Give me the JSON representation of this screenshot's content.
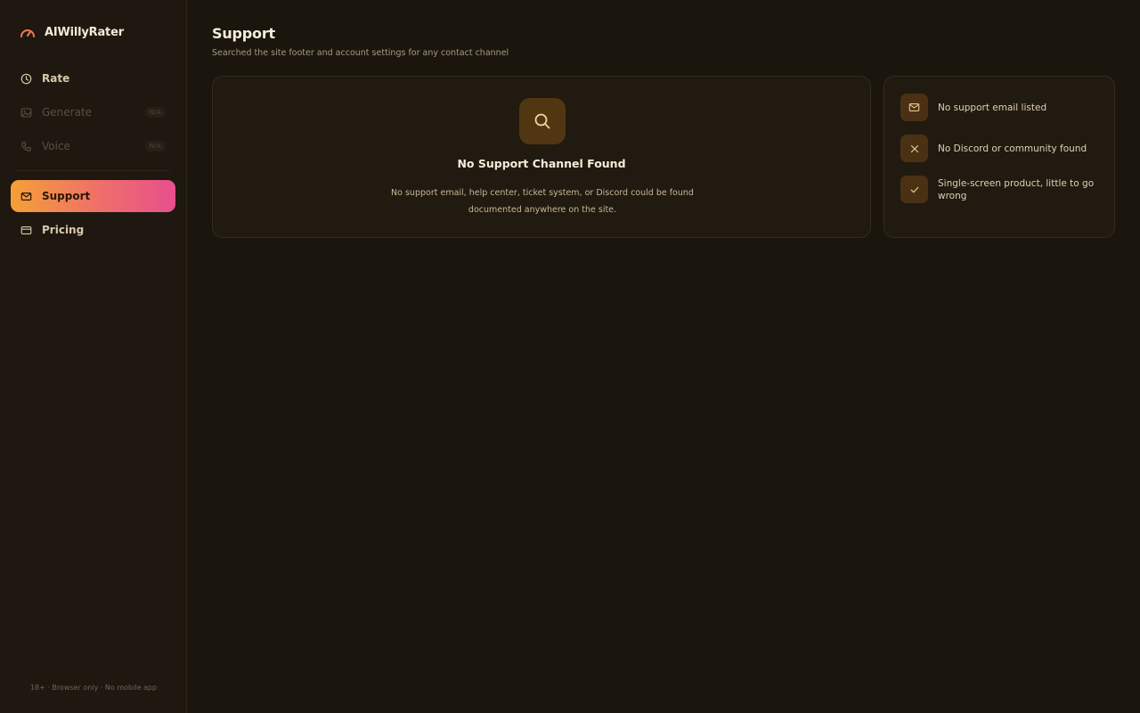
{
  "brand": {
    "name": "AIWillyRater",
    "logo_icon": "gauge-icon",
    "accent": "#f07a52"
  },
  "nav": {
    "items": [
      {
        "label": "Rate",
        "icon": "clock-icon",
        "badge": ""
      },
      {
        "label": "Generate",
        "icon": "image-icon",
        "badge": "N/A"
      },
      {
        "label": "Voice",
        "icon": "phone-icon",
        "badge": "N/A"
      },
      {
        "label": "Support",
        "icon": "mail-icon",
        "badge": ""
      },
      {
        "label": "Pricing",
        "icon": "credit-card-icon",
        "badge": ""
      }
    ],
    "active": "Support"
  },
  "footer_note": "18+ · Browser only · No mobile app",
  "page": {
    "title": "Support",
    "subtitle": "Searched the site footer and account settings for any contact channel"
  },
  "result_card": {
    "icon": "search-icon",
    "title": "No Support Channel Found",
    "line1": "No support email, help center, ticket system, or Discord could be found",
    "line2": "documented anywhere on the site."
  },
  "findings": [
    {
      "icon": "mail-icon",
      "text": "No support email listed"
    },
    {
      "icon": "x-icon",
      "text": "No Discord or community found"
    },
    {
      "icon": "check-icon",
      "text": "Single-screen product, little to go wrong"
    }
  ],
  "colors": {
    "background": "#1b160d",
    "active_gradient": [
      "#f5a037",
      "#ee6e6b",
      "#e84f8d"
    ],
    "icon_tile": "#4a3114"
  }
}
